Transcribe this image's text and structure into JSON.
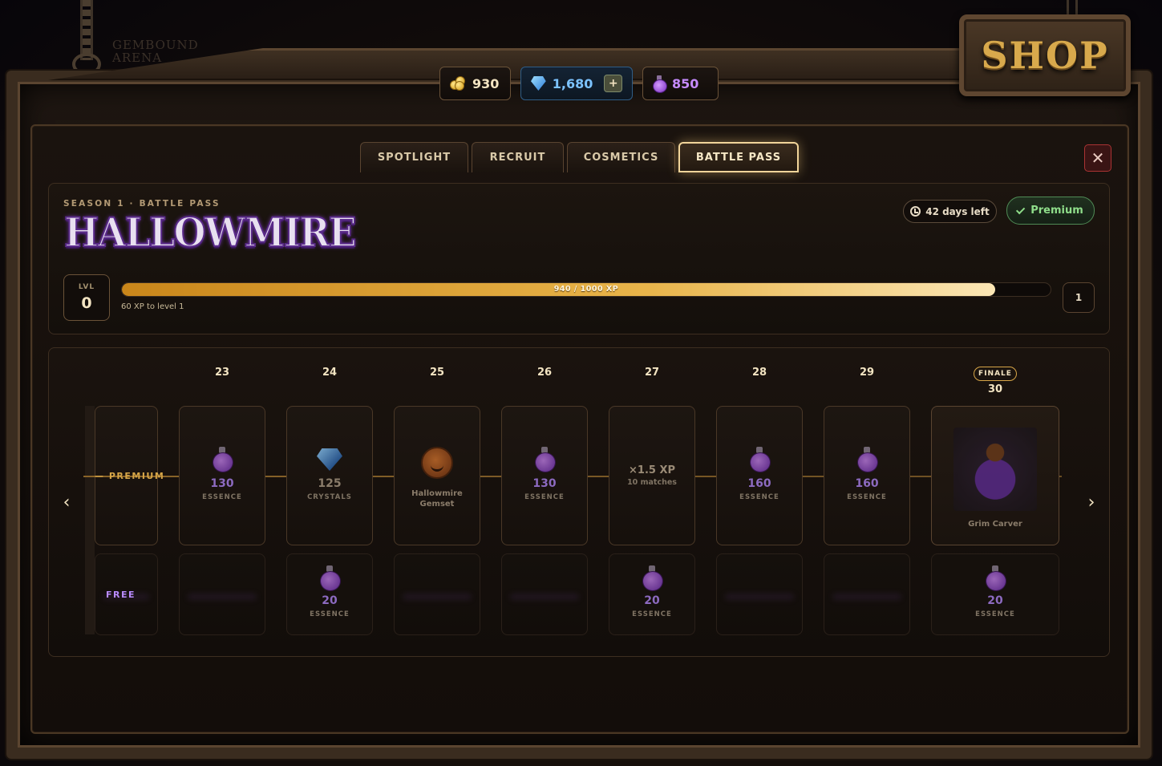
{
  "shop": {
    "title": "SHOP"
  },
  "currencies": {
    "gold": "930",
    "gems": "1,680",
    "gems_add": "+",
    "essence": "850"
  },
  "tabs": [
    {
      "label": "SPOTLIGHT"
    },
    {
      "label": "RECRUIT"
    },
    {
      "label": "COSMETICS"
    },
    {
      "label": "BATTLE PASS",
      "active": true
    }
  ],
  "close_label": "✕",
  "season": {
    "subtitle": "SEASON 1 · BATTLE PASS",
    "title": "HALLOWMIRE",
    "days_left": "42 days left",
    "premium_label": "Premium",
    "level_label": "LVL",
    "level": "0",
    "xp_text": "940 / 1000 XP",
    "xp_progress": 0.94,
    "xp_next": "60 XP to level 1",
    "next_level": "1"
  },
  "track": {
    "premium_label": "PREMIUM",
    "free_label": "FREE",
    "finale_tag": "FINALE",
    "levels": [
      {
        "level": "23",
        "premium": {
          "icon": "essence-potion-icon",
          "value": "130",
          "unit": "ESSENCE"
        },
        "free": null
      },
      {
        "level": "24",
        "premium": {
          "icon": "crystal-icon",
          "value": "125",
          "unit": "CRYSTALS"
        },
        "free": {
          "value": "20",
          "unit": "ESSENCE"
        }
      },
      {
        "level": "25",
        "premium": {
          "icon": "pumpkin-icon",
          "name_line1": "Hallowmire",
          "name_line2": "Gemset"
        },
        "free": null
      },
      {
        "level": "26",
        "premium": {
          "icon": "essence-potion-icon",
          "value": "130",
          "unit": "ESSENCE"
        },
        "free": null
      },
      {
        "level": "27",
        "premium": {
          "boost": "×1.5 XP",
          "matches": "10 matches"
        },
        "free": {
          "value": "20",
          "unit": "ESSENCE"
        }
      },
      {
        "level": "28",
        "premium": {
          "icon": "essence-potion-icon",
          "value": "160",
          "unit": "ESSENCE"
        },
        "free": null
      },
      {
        "level": "29",
        "premium": {
          "icon": "essence-potion-icon",
          "value": "160",
          "unit": "ESSENCE"
        },
        "free": null
      },
      {
        "level": "30",
        "premium": {
          "icon": "grim-carver-art",
          "name": "Grim Carver"
        },
        "free": {
          "value": "20",
          "unit": "ESSENCE"
        }
      }
    ]
  },
  "background": {
    "logo_line1": "GEMBOUND",
    "logo_line2": "ARENA"
  },
  "colors": {
    "gold_accent": "#d7a648",
    "premium_green": "#8fdd8a",
    "essence_purple": "#c68bff",
    "gem_blue": "#7cc3ff",
    "close_red": "#a33333"
  }
}
